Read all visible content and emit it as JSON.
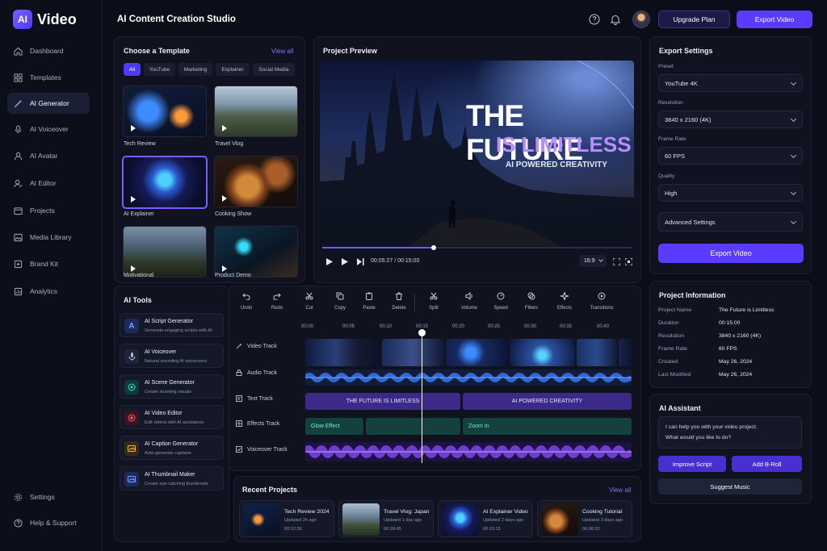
{
  "app": {
    "logo_mark": "AI",
    "logo_text": "Video",
    "title": "AI Content Creation Studio"
  },
  "sidebar": {
    "items": [
      {
        "label": "Dashboard",
        "icon": "home-icon"
      },
      {
        "label": "Templates",
        "icon": "grid-icon"
      },
      {
        "label": "AI Generator",
        "icon": "wand-icon",
        "active": true
      },
      {
        "label": "AI Voiceover",
        "icon": "mic-icon"
      },
      {
        "label": "AI Avatar",
        "icon": "user-icon"
      },
      {
        "label": "AI Editor",
        "icon": "user-edit-icon"
      },
      {
        "label": "Projects",
        "icon": "folder-icon"
      },
      {
        "label": "Media Library",
        "icon": "image-icon"
      },
      {
        "label": "Brand Kit",
        "icon": "box-icon"
      },
      {
        "label": "Analytics",
        "icon": "chart-icon"
      }
    ],
    "bottom": [
      {
        "label": "Settings",
        "icon": "gear-icon"
      },
      {
        "label": "Help & Support",
        "icon": "help-icon"
      }
    ]
  },
  "header": {
    "upgrade_label": "Upgrade Plan",
    "export_label": "Export Video"
  },
  "templates": {
    "title": "Choose a Template",
    "view_all": "View all",
    "filters": [
      "All",
      "YouTube",
      "Marketing",
      "Explainer",
      "Social Media"
    ],
    "items": [
      "Tech Review",
      "Travel Vlog",
      "AI Explainer",
      "Cooking Show",
      "Motivational",
      "Product Demo"
    ]
  },
  "preview": {
    "title": "Project Preview",
    "headline": "THE FUTURE",
    "subheadline": "IS LIMITLESS",
    "tagline": "AI POWERED CREATIVITY",
    "time": "00:05:27 / 00:15:00",
    "aspect": "16:9",
    "progress": 0.36
  },
  "export": {
    "title": "Export Settings",
    "preset_label": "Preset",
    "preset": "YouTube 4K",
    "resolution_label": "Resolution",
    "resolution": "3840 x 2160 (4K)",
    "framerate_label": "Frame Rate",
    "framerate": "60 FPS",
    "quality_label": "Quality",
    "quality": "High",
    "advanced": "Advanced Settings",
    "button": "Export Video"
  },
  "project_info": {
    "title": "Project Information",
    "rows": [
      {
        "k": "Project Name",
        "v": "The Future is Limitless"
      },
      {
        "k": "Duration",
        "v": "00:15:00"
      },
      {
        "k": "Resolution",
        "v": "3840 x 2160 (4K)"
      },
      {
        "k": "Frame Rate",
        "v": "60 FPS"
      },
      {
        "k": "Created",
        "v": "May 26, 2024"
      },
      {
        "k": "Last Modified",
        "v": "May 26, 2024"
      }
    ]
  },
  "assistant": {
    "title": "AI Assistant",
    "message_line1": "I can help you with your video project.",
    "message_line2": "What would you like to do?",
    "btn1": "Improve Script",
    "btn2": "Add B-Roll",
    "btn3": "Suggest Music"
  },
  "ai_tools": {
    "title": "AI Tools",
    "items": [
      {
        "name": "AI Script Generator",
        "desc": "Generate engaging scripts with AI"
      },
      {
        "name": "AI Voiceover",
        "desc": "Natural sounding AI voiceovers"
      },
      {
        "name": "AI Scene Generator",
        "desc": "Create stunning visuals"
      },
      {
        "name": "AI Video Editor",
        "desc": "Edit videos with AI assistance"
      },
      {
        "name": "AI Caption Generator",
        "desc": "Auto-generate captions"
      },
      {
        "name": "AI Thumbnail Maker",
        "desc": "Create eye-catching thumbnails"
      }
    ]
  },
  "toolbar": [
    "Undo",
    "Redo",
    "Cut",
    "Copy",
    "Paste",
    "Delete",
    "Split",
    "Volume",
    "Speed",
    "Filters",
    "Effects",
    "Transitions"
  ],
  "timeline": {
    "ticks": [
      "00:00",
      "00:05",
      "00:10",
      "00:15",
      "00:20",
      "00:25",
      "00:30",
      "00:35",
      "00:40"
    ],
    "tracks": [
      "Video Track",
      "Audio Track",
      "Text Track",
      "Effects Track",
      "Voiceover Track"
    ],
    "text_clips": [
      "THE FUTURE IS LIMITLESS",
      "AI POWERED CREATIVITY"
    ],
    "effect_clips": [
      "Glow Effect",
      "Zoom In"
    ]
  },
  "recent": {
    "title": "Recent Projects",
    "view_all": "View all",
    "items": [
      {
        "name": "Tech Review 2024",
        "updated": "Updated 2h ago",
        "duration": "00:12:30"
      },
      {
        "name": "Travel Vlog: Japan",
        "updated": "Updated 1 day ago",
        "duration": "00:18:45"
      },
      {
        "name": "AI Explainer Video",
        "updated": "Updated 2 days ago",
        "duration": "00:10:15"
      },
      {
        "name": "Cooking Tutorial",
        "updated": "Updated 3 days ago",
        "duration": "00:08:20"
      }
    ]
  },
  "colors": {
    "accent": "#5b3bff",
    "text_clip": "#3b2a8a",
    "effect_clip": "#14403f"
  }
}
